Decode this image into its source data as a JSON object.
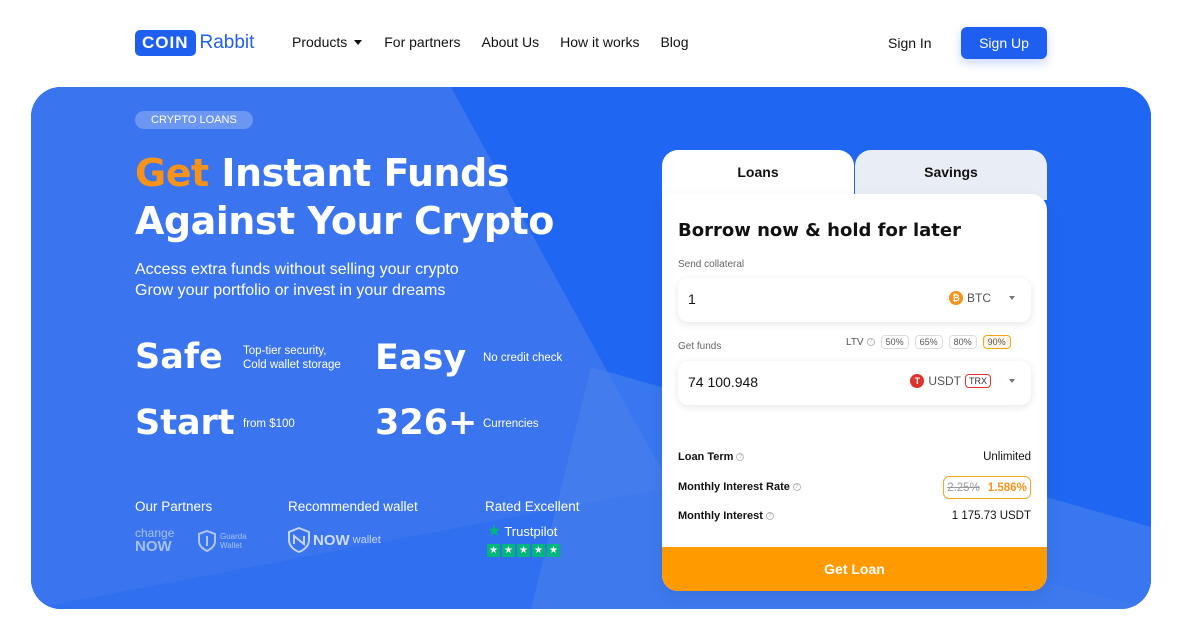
{
  "header": {
    "logo_coin": "COIN",
    "logo_rabbit": "Rabbit",
    "nav": {
      "products": "Products",
      "partners": "For partners",
      "about": "About Us",
      "how": "How it works",
      "blog": "Blog"
    },
    "signin": "Sign In",
    "signup": "Sign Up"
  },
  "hero": {
    "badge": "CRYPTO LOANS",
    "headline_accent": "Get",
    "headline_rest": "Instant Funds",
    "headline_line2": "Against Your Crypto",
    "sub_line1": "Access extra funds without selling your crypto",
    "sub_line2": "Grow your portfolio or invest in your dreams",
    "stats": {
      "safe": "Safe",
      "safe_desc1": "Top-tier security,",
      "safe_desc2": "Cold wallet storage",
      "easy": "Easy",
      "easy_desc": "No credit check",
      "start": "Start",
      "start_desc": "from $100",
      "currencies": "326+",
      "currencies_desc": "Currencies"
    },
    "partners_title": "Our Partners",
    "wallet_title": "Recommended wallet",
    "rated_title": "Rated Excellent",
    "partner_changenow_1": "change",
    "partner_changenow_2": "NOW",
    "partner_guarda_1": "Guarda",
    "partner_guarda_2": "Wallet",
    "nowwallet_now": "NOW",
    "nowwallet_wallet": "wallet",
    "trustpilot": "Trustpilot"
  },
  "card": {
    "tab_loans": "Loans",
    "tab_savings": "Savings",
    "title": "Borrow now & hold for later",
    "send_label": "Send collateral",
    "send_value": "1",
    "send_currency": "BTC",
    "get_label": "Get funds",
    "ltv_label": "LTV",
    "ltv_options": [
      "50%",
      "65%",
      "80%",
      "90%"
    ],
    "ltv_selected": "90%",
    "get_value": "74 100.948",
    "get_currency": "USDT",
    "get_network": "TRX",
    "loan_term_label": "Loan Term",
    "loan_term_value": "Unlimited",
    "rate_label": "Monthly Interest Rate",
    "rate_old": "2.25%",
    "rate_new": "1.586%",
    "interest_label": "Monthly Interest",
    "interest_value": "1 175.73 USDT",
    "cta": "Get Loan"
  },
  "colors": {
    "brand": "#1f5ff0",
    "accent_orange": "#f7931a",
    "cta": "#ff9a00",
    "trustpilot_green": "#00b67a"
  }
}
